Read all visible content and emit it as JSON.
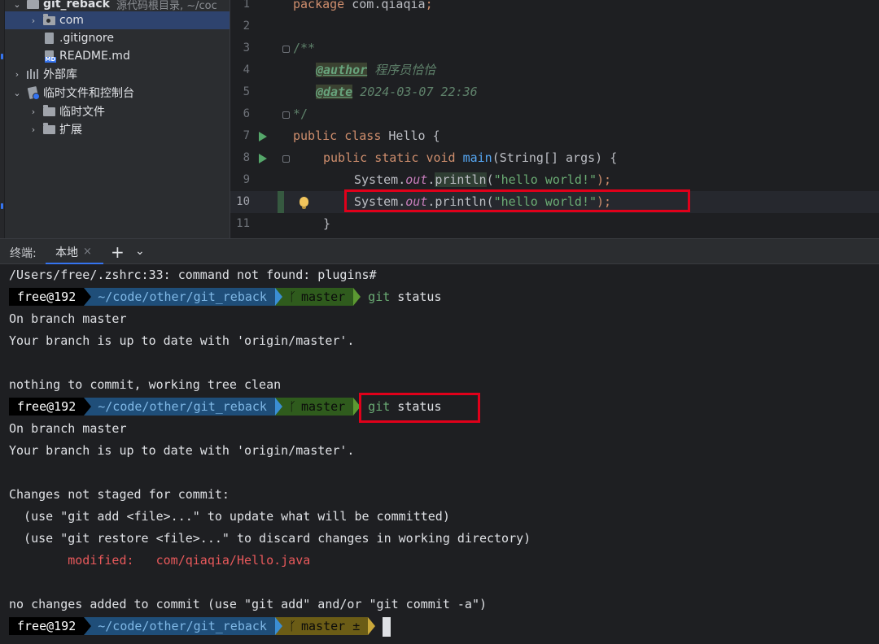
{
  "project_tree": {
    "items": [
      {
        "label": "git_reback",
        "hint": "源代码根目录, ~/coc"
      },
      {
        "label": "com"
      },
      {
        "label": ".gitignore"
      },
      {
        "label": "README.md"
      },
      {
        "label": "外部库"
      },
      {
        "label": "临时文件和控制台"
      },
      {
        "label": "临时文件"
      },
      {
        "label": "扩展"
      }
    ]
  },
  "editor": {
    "lines": [
      {
        "num": "1",
        "package_kw": "package",
        "package_name": "com.qiaqia",
        "semicolon": ";"
      },
      {
        "num": "2"
      },
      {
        "num": "3",
        "text": "/**"
      },
      {
        "num": "4",
        "tag": "@author",
        "value": "程序员恰恰"
      },
      {
        "num": "5",
        "tag": "@date",
        "value": "2024-03-07 22:36"
      },
      {
        "num": "6",
        "text": "*/"
      },
      {
        "num": "7",
        "kw1": "public",
        "kw2": "class",
        "name": "Hello",
        "brace": "{"
      },
      {
        "num": "8",
        "kw1": "public",
        "kw2": "static",
        "kw3": "void",
        "name": "main",
        "paren_open": "(",
        "type": "String[]",
        "param": "args",
        "paren_close": ")",
        "brace": "{"
      },
      {
        "num": "9",
        "obj": "System",
        "dot1": ".",
        "field": "out",
        "dot2": ".",
        "method": "println",
        "open": "(",
        "arg": "\"hello world!\"",
        "close": ");"
      },
      {
        "num": "10",
        "obj": "System",
        "dot1": ".",
        "field": "out",
        "dot2": ".",
        "method": "println",
        "open": "(",
        "arg": "\"hello world!\"",
        "close": ");"
      },
      {
        "num": "11",
        "text": "}"
      }
    ]
  },
  "terminal_header": {
    "label": "终端:",
    "tab_label": "本地",
    "tab_close": "×",
    "plus": "+",
    "chevron": "⌄"
  },
  "terminal": {
    "prompt_user": "free@192",
    "prompt_path": "~/code/other/git_reback",
    "branch_clean": "master",
    "branch_dirty": "master ±",
    "branch_glyph": "ᚴ",
    "cmd_git": "git",
    "cmd_arg": "status",
    "lines": {
      "l0": "/Users/free/.zshrc:33: command not found: plugins#",
      "l2": "On branch master",
      "l3": "Your branch is up to date with 'origin/master'.",
      "l5": "nothing to commit, working tree clean",
      "l7": "On branch master",
      "l8": "Your branch is up to date with 'origin/master'.",
      "l10": "Changes not staged for commit:",
      "l11": "  (use \"git add <file>...\" to update what will be committed)",
      "l12": "  (use \"git restore <file>...\" to discard changes in working directory)",
      "l13": "        modified:   com/qiaqia/Hello.java",
      "l15": "no changes added to commit (use \"git add\" and/or \"git commit -a\")"
    }
  },
  "colors": {
    "accent": "#3574f0",
    "highlight_box": "#e0001a",
    "modified": "#e8595b"
  }
}
